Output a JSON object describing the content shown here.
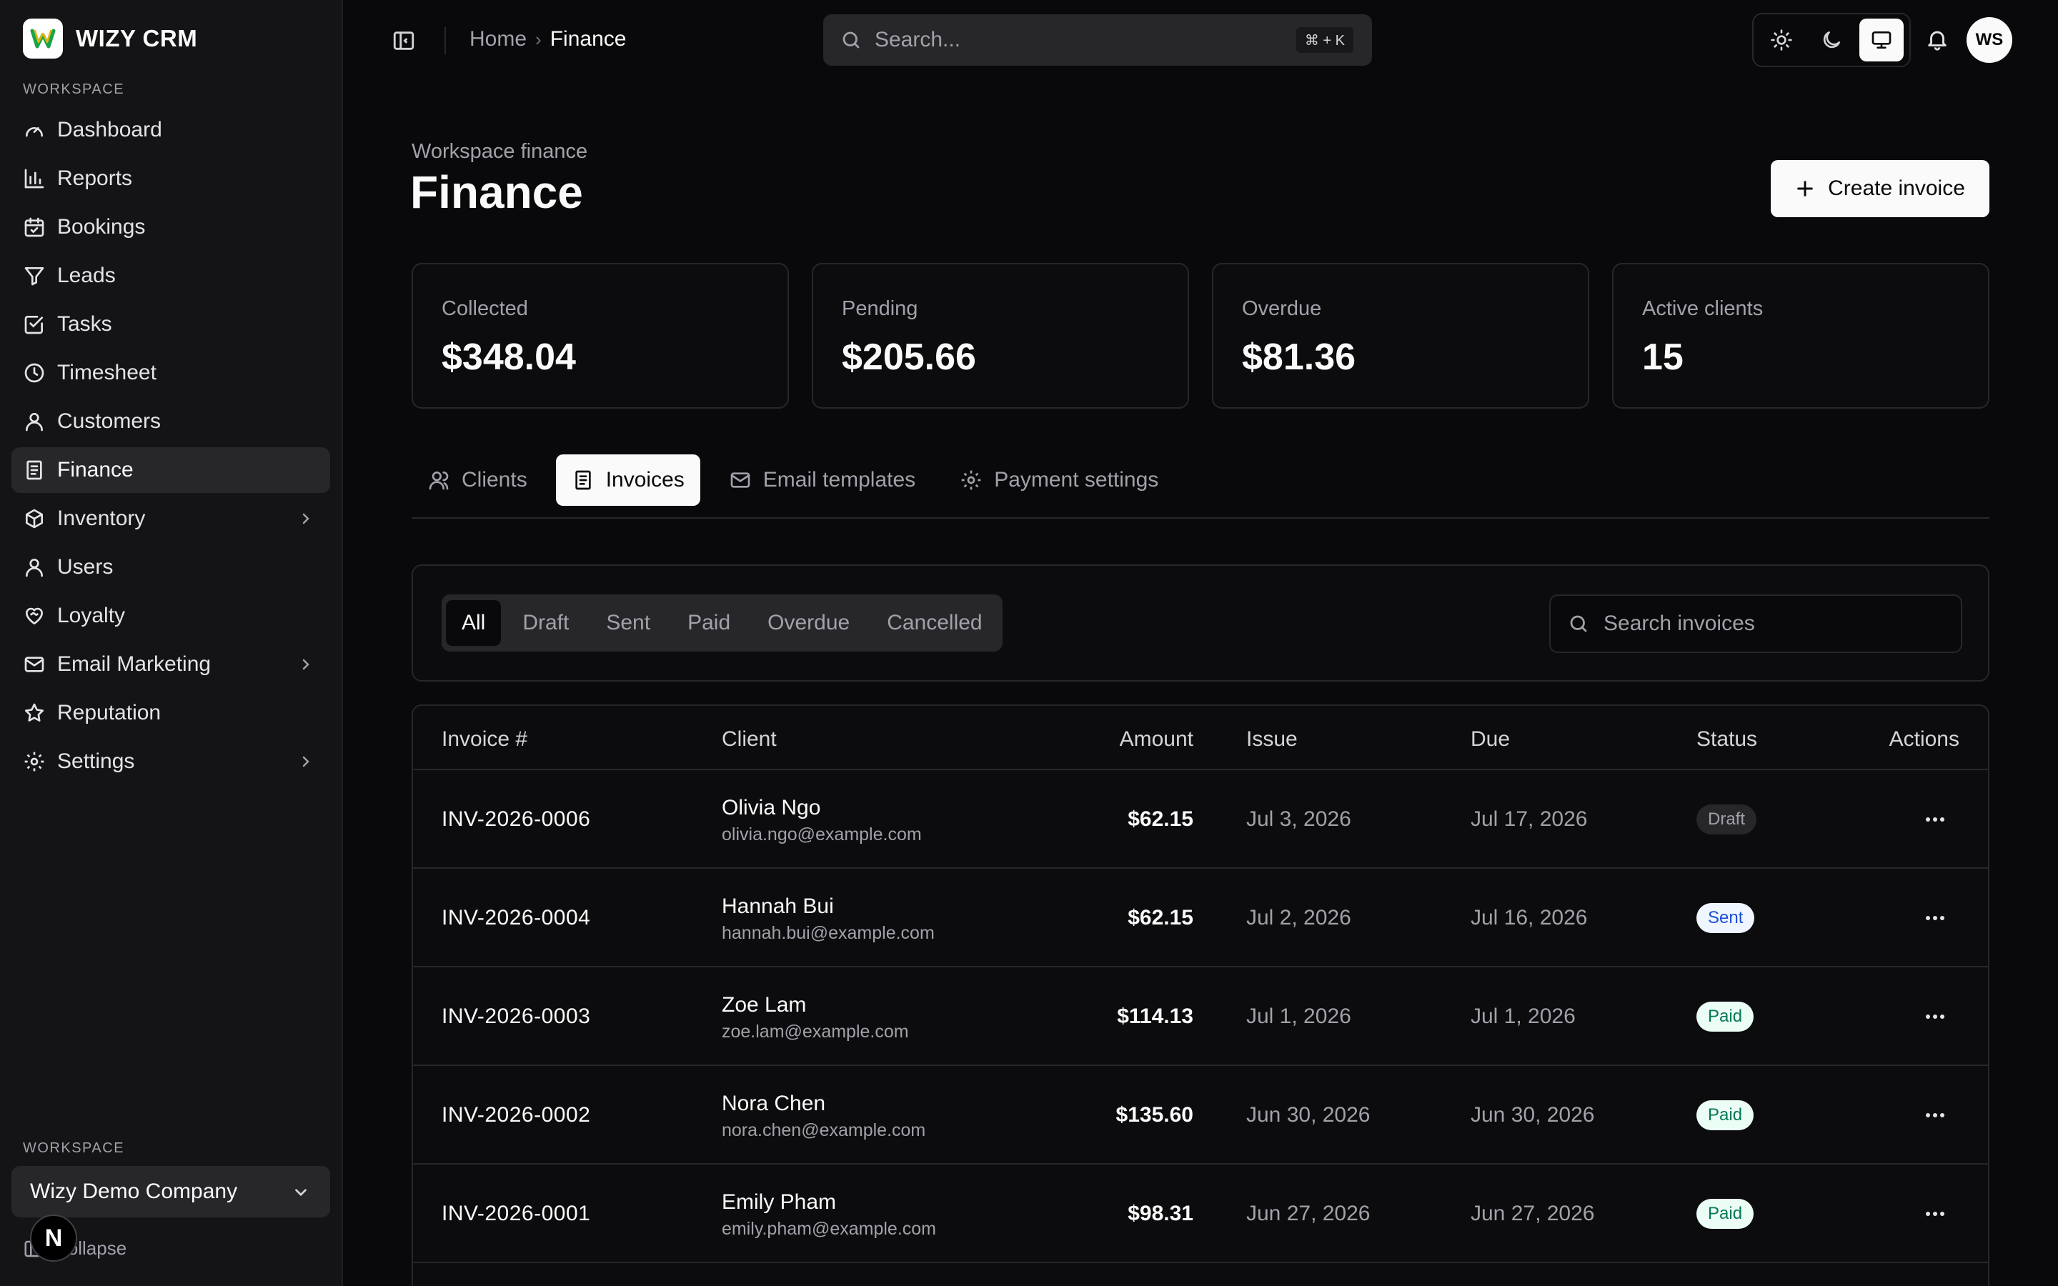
{
  "brand": {
    "name": "WIZY CRM"
  },
  "sidebar": {
    "section_label": "WORKSPACE",
    "items": [
      {
        "label": "Dashboard",
        "icon": "gauge-icon",
        "active": false
      },
      {
        "label": "Reports",
        "icon": "bar-chart-icon",
        "active": false
      },
      {
        "label": "Bookings",
        "icon": "calendar-icon",
        "active": false
      },
      {
        "label": "Leads",
        "icon": "filter-icon",
        "active": false
      },
      {
        "label": "Tasks",
        "icon": "checkbox-icon",
        "active": false
      },
      {
        "label": "Timesheet",
        "icon": "clock-icon",
        "active": false
      },
      {
        "label": "Customers",
        "icon": "user-icon",
        "active": false
      },
      {
        "label": "Finance",
        "icon": "receipt-icon",
        "active": true
      },
      {
        "label": "Inventory",
        "icon": "package-icon",
        "active": false,
        "expandable": true
      },
      {
        "label": "Users",
        "icon": "user-icon",
        "active": false
      },
      {
        "label": "Loyalty",
        "icon": "heart-handshake-icon",
        "active": false
      },
      {
        "label": "Email Marketing",
        "icon": "mail-icon",
        "active": false,
        "expandable": true
      },
      {
        "label": "Reputation",
        "icon": "star-icon",
        "active": false
      },
      {
        "label": "Settings",
        "icon": "gear-icon",
        "active": false,
        "expandable": true
      }
    ],
    "workspace_label": "WORKSPACE",
    "workspace_value": "Wizy Demo Company",
    "collapse_label": "Collapse",
    "n_badge": "N"
  },
  "header": {
    "breadcrumb": [
      "Home",
      "Finance"
    ],
    "breadcrumb_sep": "›",
    "search_placeholder": "Search...",
    "search_shortcut": "⌘ + K",
    "theme_active": "system",
    "avatar_initials": "WS"
  },
  "page": {
    "eyebrow": "Workspace finance",
    "title": "Finance",
    "create_label": "Create invoice"
  },
  "stats": [
    {
      "label": "Collected",
      "value": "$348.04"
    },
    {
      "label": "Pending",
      "value": "$205.66"
    },
    {
      "label": "Overdue",
      "value": "$81.36"
    },
    {
      "label": "Active clients",
      "value": "15"
    }
  ],
  "tabs": [
    {
      "label": "Clients",
      "icon": "users-icon",
      "active": false
    },
    {
      "label": "Invoices",
      "icon": "receipt-icon",
      "active": true
    },
    {
      "label": "Email templates",
      "icon": "mail-icon",
      "active": false
    },
    {
      "label": "Payment settings",
      "icon": "gear-icon",
      "active": false
    }
  ],
  "filters": {
    "options": [
      "All",
      "Draft",
      "Sent",
      "Paid",
      "Overdue",
      "Cancelled"
    ],
    "active": "All",
    "search_placeholder": "Search invoices"
  },
  "table": {
    "columns": [
      "Invoice #",
      "Client",
      "Amount",
      "Issue",
      "Due",
      "Status",
      "Actions"
    ],
    "rows": [
      {
        "invoice": "INV-2026-0006",
        "name": "Olivia Ngo",
        "email": "olivia.ngo@example.com",
        "amount": "$62.15",
        "issue": "Jul 3, 2026",
        "due": "Jul 17, 2026",
        "status": "Draft"
      },
      {
        "invoice": "INV-2026-0004",
        "name": "Hannah Bui",
        "email": "hannah.bui@example.com",
        "amount": "$62.15",
        "issue": "Jul 2, 2026",
        "due": "Jul 16, 2026",
        "status": "Sent"
      },
      {
        "invoice": "INV-2026-0003",
        "name": "Zoe Lam",
        "email": "zoe.lam@example.com",
        "amount": "$114.13",
        "issue": "Jul 1, 2026",
        "due": "Jul 1, 2026",
        "status": "Paid"
      },
      {
        "invoice": "INV-2026-0002",
        "name": "Nora Chen",
        "email": "nora.chen@example.com",
        "amount": "$135.60",
        "issue": "Jun 30, 2026",
        "due": "Jun 30, 2026",
        "status": "Paid"
      },
      {
        "invoice": "INV-2026-0001",
        "name": "Emily Pham",
        "email": "emily.pham@example.com",
        "amount": "$98.31",
        "issue": "Jun 27, 2026",
        "due": "Jun 27, 2026",
        "status": "Paid"
      }
    ]
  },
  "colors": {
    "background": "#09090b",
    "sidebar": "#141416",
    "border": "#27272a",
    "text_muted": "#a1a1aa",
    "paid": "#047857",
    "sent": "#1d4ed8"
  }
}
